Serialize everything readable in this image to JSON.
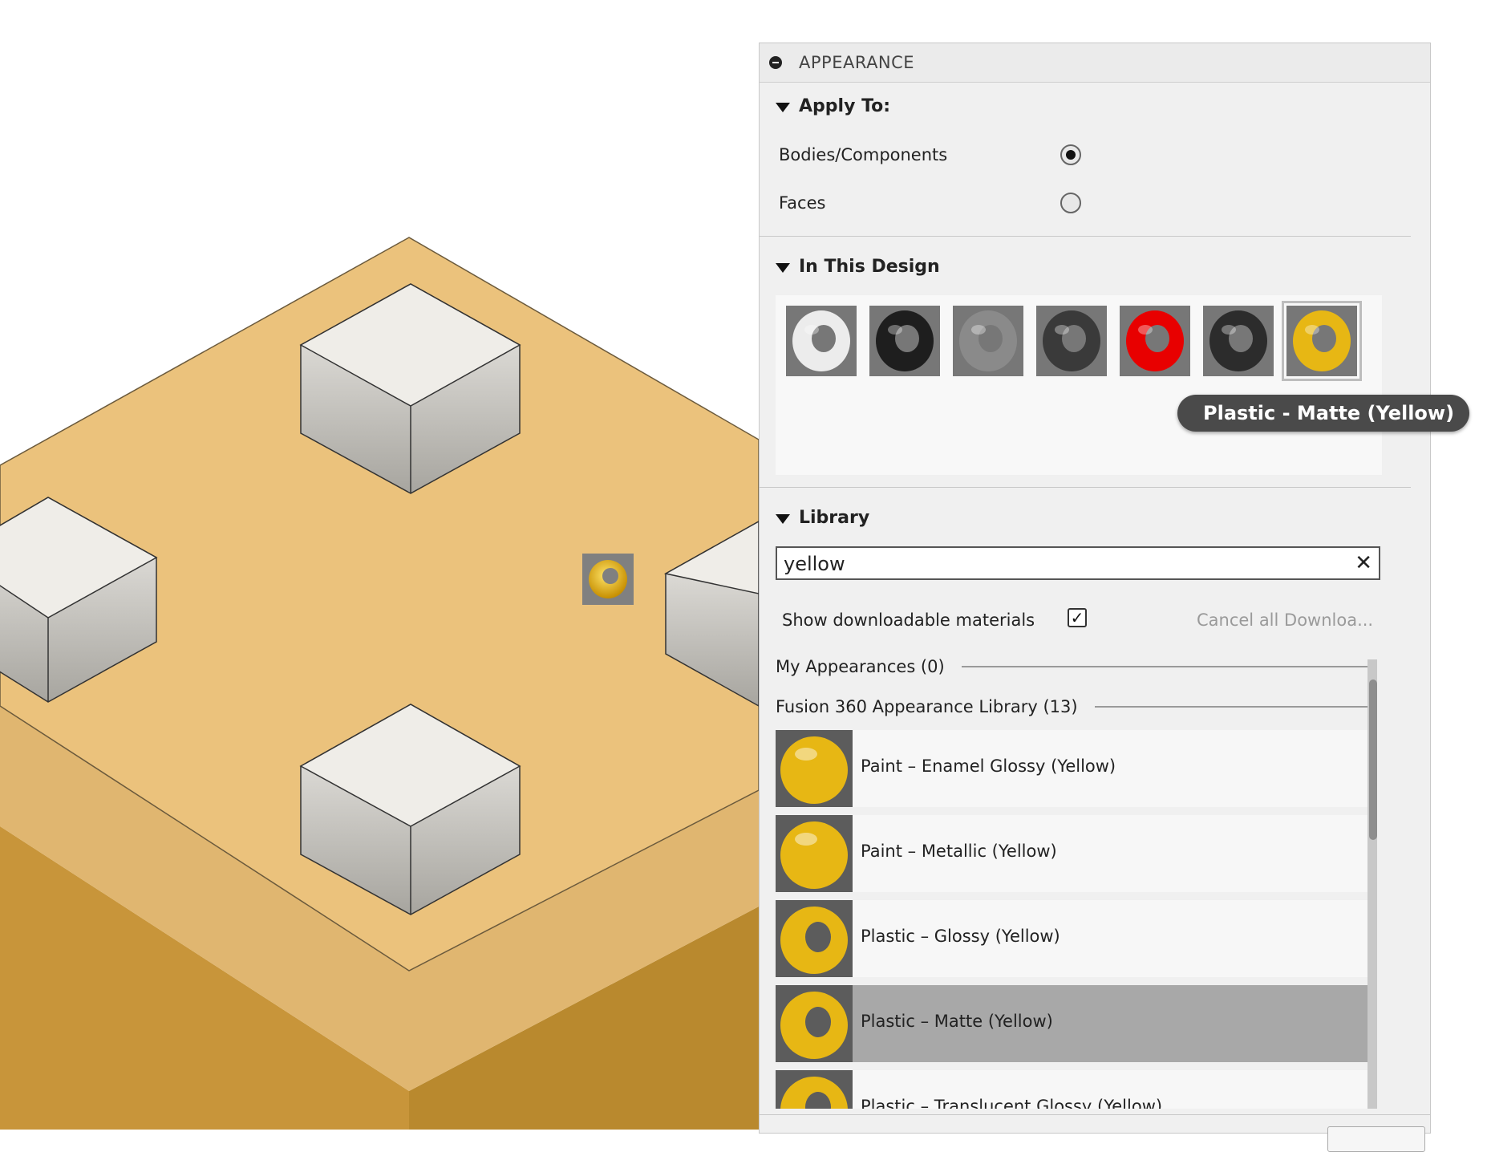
{
  "panel": {
    "title": "APPEARANCE",
    "apply_to": {
      "heading": "Apply To:",
      "options": [
        {
          "label": "Bodies/Components",
          "selected": true
        },
        {
          "label": "Faces",
          "selected": false
        }
      ]
    },
    "in_this_design": {
      "heading": "In This Design",
      "swatches": [
        {
          "name": "white-material-swatch",
          "color": "#ececec"
        },
        {
          "name": "black-material-swatch",
          "color": "#1e1e1e"
        },
        {
          "name": "gray-translucent-material-swatch",
          "color": "#8a8a8a"
        },
        {
          "name": "dark-chrome-material-swatch",
          "color": "#3a3a3a"
        },
        {
          "name": "red-material-swatch",
          "color": "#e80000"
        },
        {
          "name": "dark-metal-material-swatch",
          "color": "#2c2c2c"
        },
        {
          "name": "yellow-matte-material-swatch",
          "color": "#e7b714",
          "selected": true
        }
      ],
      "tooltip": "Plastic - Matte (Yellow)"
    },
    "library": {
      "heading": "Library",
      "search_value": "yellow",
      "show_downloadable_label": "Show downloadable materials",
      "show_downloadable_checked": true,
      "cancel_downloads_label": "Cancel all Downloa...",
      "groups": [
        {
          "label": "My Appearances (0)"
        },
        {
          "label": "Fusion 360 Appearance Library (13)"
        }
      ],
      "items": [
        {
          "label": "Paint – Enamel Glossy (Yellow)",
          "shape": "sphere",
          "selected": false
        },
        {
          "label": "Paint – Metallic (Yellow)",
          "shape": "sphere",
          "selected": false
        },
        {
          "label": "Plastic – Glossy (Yellow)",
          "shape": "torus",
          "selected": false
        },
        {
          "label": "Plastic – Matte (Yellow)",
          "shape": "torus",
          "selected": true
        },
        {
          "label": "Plastic – Translucent Glossy (Yellow)",
          "shape": "torus",
          "selected": false
        }
      ]
    }
  },
  "colors": {
    "model_top": "#ebc27c",
    "model_side": "#c8953a",
    "stud": "#e8e6e0",
    "accent_yellow": "#e7b714"
  }
}
